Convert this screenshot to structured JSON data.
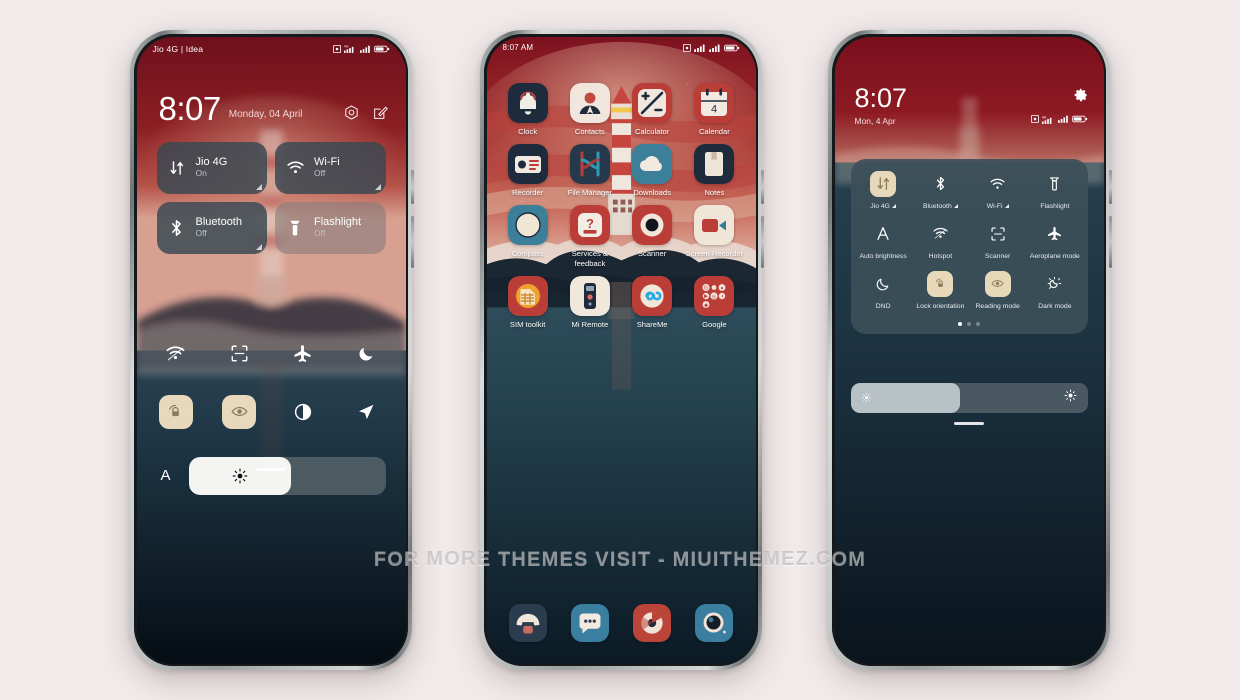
{
  "background_color": "#f1eaea",
  "watermark": "FOR MORE THEMES VISIT - MIUITHEMEZ.COM",
  "phone1": {
    "name": "lockscreen-control-center",
    "statusbar": {
      "carrier": "Jio 4G | Idea",
      "icons": [
        "alarm-icon",
        "signal-4g-icon",
        "signal-icon",
        "battery-icon"
      ]
    },
    "clock": "8:07",
    "date": "Monday, 04 April",
    "header_icons": [
      "camera-icon",
      "edit-icon"
    ],
    "big_tiles": [
      {
        "icon": "data-arrows-icon",
        "title": "Jio 4G",
        "state": "On",
        "lit": false,
        "expandable": true
      },
      {
        "icon": "wifi-icon",
        "title": "Wi-Fi",
        "state": "Off",
        "lit": false,
        "expandable": true
      },
      {
        "icon": "bluetooth-icon",
        "title": "Bluetooth",
        "state": "Off",
        "lit": false,
        "expandable": true
      },
      {
        "icon": "flashlight-icon",
        "title": "Flashlight",
        "state": "Off",
        "lit": true,
        "expandable": false
      }
    ],
    "mini_row_1": [
      "hotspot-icon",
      "scanner-icon",
      "aeroplane-icon",
      "dnd-moon-icon"
    ],
    "mini_row_2": [
      "lock-orientation-icon",
      "reading-mode-icon",
      "dark-mode-icon",
      "location-icon"
    ],
    "mini_row_2_on": [
      true,
      true,
      false,
      false
    ],
    "brightness": {
      "auto_label": "A",
      "value_percent": 52
    }
  },
  "phone2": {
    "name": "home-screen",
    "statusbar": {
      "time": "8:07 AM",
      "icons": [
        "alarm-icon",
        "signal-4g-icon",
        "signal-icon",
        "battery-icon"
      ]
    },
    "apps": [
      [
        {
          "label": "Clock",
          "icon": "clock-bell-icon"
        },
        {
          "label": "Contacts",
          "icon": "contacts-person-icon"
        },
        {
          "label": "Calculator",
          "icon": "calculator-icon"
        },
        {
          "label": "Calendar",
          "icon": "calendar-icon",
          "day": "4"
        }
      ],
      [
        {
          "label": "Recorder",
          "icon": "recorder-icon"
        },
        {
          "label": "File Manager",
          "icon": "file-manager-icon"
        },
        {
          "label": "Downloads",
          "icon": "downloads-cloud-icon"
        },
        {
          "label": "Notes",
          "icon": "notes-book-icon"
        }
      ],
      [
        {
          "label": "Compass",
          "icon": "compass-icon"
        },
        {
          "label": "Services & feedback",
          "icon": "services-feedback-icon"
        },
        {
          "label": "Scanner",
          "icon": "scanner-lens-icon"
        },
        {
          "label": "Screen Recorder",
          "icon": "screen-recorder-icon"
        }
      ],
      [
        {
          "label": "SIM toolkit",
          "icon": "sim-toolkit-icon"
        },
        {
          "label": "Mi Remote",
          "icon": "mi-remote-icon"
        },
        {
          "label": "ShareMe",
          "icon": "shareme-icon"
        },
        {
          "label": "Google",
          "icon": "google-folder-icon"
        }
      ]
    ],
    "dock": [
      {
        "label": "Phone",
        "icon": "phone-dialer-icon"
      },
      {
        "label": "Messages",
        "icon": "messages-icon"
      },
      {
        "label": "Browser",
        "icon": "browser-icon"
      },
      {
        "label": "Camera",
        "icon": "camera-icon"
      }
    ]
  },
  "phone3": {
    "name": "control-center",
    "clock": "8:07",
    "date": "Mon, 4 Apr",
    "settings_icon": "gear-icon",
    "statusbar_icons": [
      "alarm-icon",
      "signal-4g-icon",
      "signal-icon",
      "battery-icon"
    ],
    "tiles": [
      {
        "label": "Jio 4G",
        "icon": "data-arrows-icon",
        "on": true,
        "expandable": true
      },
      {
        "label": "Bluetooth",
        "icon": "bluetooth-icon",
        "on": false,
        "expandable": true
      },
      {
        "label": "Wi-Fi",
        "icon": "wifi-icon",
        "on": false,
        "expandable": true
      },
      {
        "label": "Flashlight",
        "icon": "flashlight-icon",
        "on": false,
        "expandable": false
      },
      {
        "label": "Auto brightness",
        "icon": "auto-brightness-icon",
        "on": false,
        "expandable": false
      },
      {
        "label": "Hotspot",
        "icon": "hotspot-icon",
        "on": false,
        "expandable": false
      },
      {
        "label": "Scanner",
        "icon": "scanner-icon",
        "on": false,
        "expandable": false
      },
      {
        "label": "Aeroplane mode",
        "icon": "aeroplane-icon",
        "on": false,
        "expandable": false
      },
      {
        "label": "DND",
        "icon": "dnd-moon-icon",
        "on": false,
        "expandable": false
      },
      {
        "label": "Lock orientation",
        "icon": "lock-orientation-icon",
        "on": true,
        "expandable": false
      },
      {
        "label": "Reading mode",
        "icon": "reading-mode-icon",
        "on": true,
        "expandable": false
      },
      {
        "label": "Dark mode",
        "icon": "dark-mode-icon",
        "on": false,
        "expandable": false
      }
    ],
    "page_dots": {
      "count": 3,
      "active": 0
    },
    "brightness": {
      "value_percent": 46
    }
  }
}
